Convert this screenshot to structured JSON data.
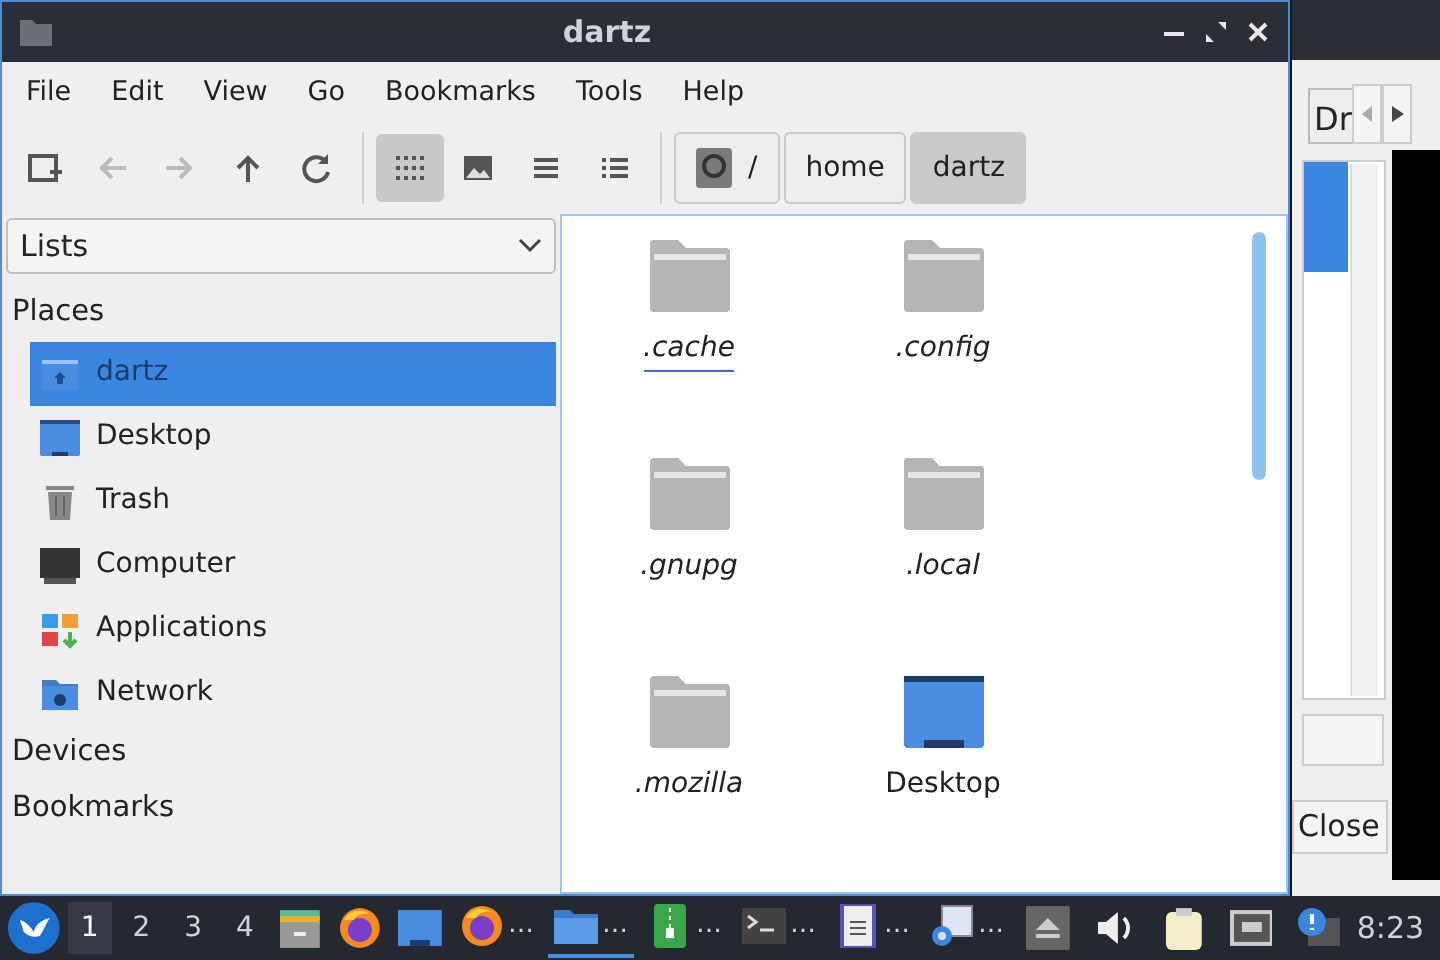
{
  "window": {
    "title": "dartz"
  },
  "menu": [
    "File",
    "Edit",
    "View",
    "Go",
    "Bookmarks",
    "Tools",
    "Help"
  ],
  "toolbar": {
    "nav": [
      {
        "kind": "newtab",
        "disabled": false
      },
      {
        "kind": "back",
        "disabled": true
      },
      {
        "kind": "forward",
        "disabled": true
      },
      {
        "kind": "up",
        "disabled": false
      },
      {
        "kind": "reload",
        "disabled": false
      }
    ],
    "views": [
      {
        "kind": "icons",
        "selected": true
      },
      {
        "kind": "thumbs",
        "selected": false
      },
      {
        "kind": "compact",
        "selected": false
      },
      {
        "kind": "detail",
        "selected": false
      }
    ],
    "path": [
      {
        "kind": "root",
        "label": "/",
        "selected": false
      },
      {
        "kind": "dir",
        "label": "home",
        "selected": false
      },
      {
        "kind": "dir",
        "label": "dartz",
        "selected": true
      }
    ]
  },
  "sidebar": {
    "dropdown": "Lists",
    "sections": [
      {
        "title": "Places",
        "items": [
          {
            "kind": "home",
            "label": "dartz",
            "selected": true
          },
          {
            "kind": "desktop",
            "label": "Desktop",
            "selected": false
          },
          {
            "kind": "trash",
            "label": "Trash",
            "selected": false
          },
          {
            "kind": "computer",
            "label": "Computer",
            "selected": false
          },
          {
            "kind": "apps",
            "label": "Applications",
            "selected": false
          },
          {
            "kind": "network",
            "label": "Network",
            "selected": false
          }
        ]
      },
      {
        "title": "Devices"
      },
      {
        "title": "Bookmarks"
      }
    ]
  },
  "files": [
    {
      "kind": "folder",
      "name": ".cache",
      "hidden": true,
      "focused": true
    },
    {
      "kind": "folder",
      "name": ".config",
      "hidden": true,
      "focused": false
    },
    {
      "kind": "folder",
      "name": ".gnupg",
      "hidden": true,
      "focused": false
    },
    {
      "kind": "folder",
      "name": ".local",
      "hidden": true,
      "focused": false
    },
    {
      "kind": "folder",
      "name": ".mozilla",
      "hidden": true,
      "focused": false
    },
    {
      "kind": "desktop",
      "name": "Desktop",
      "hidden": false,
      "focused": false
    }
  ],
  "back_window": {
    "tab": "Dr",
    "close_button": "Close"
  },
  "taskbar": {
    "workspaces": [
      {
        "label": "1",
        "selected": true
      },
      {
        "label": "2",
        "selected": false
      },
      {
        "label": "3",
        "selected": false
      },
      {
        "label": "4",
        "selected": false
      }
    ],
    "launchers": [
      {
        "kind": "cabinet"
      },
      {
        "kind": "firefox"
      },
      {
        "kind": "showdesktop"
      }
    ],
    "tasks": [
      {
        "kind": "firefox",
        "label": "…",
        "active": false
      },
      {
        "kind": "files",
        "label": "…",
        "active": true
      },
      {
        "kind": "archive",
        "label": "…",
        "active": false
      },
      {
        "kind": "terminal",
        "label": "…",
        "active": false
      },
      {
        "kind": "document",
        "label": "…",
        "active": false
      },
      {
        "kind": "settings",
        "label": "…",
        "active": false
      }
    ],
    "tray": [
      {
        "kind": "eject"
      },
      {
        "kind": "volume"
      },
      {
        "kind": "clipboard"
      },
      {
        "kind": "network"
      },
      {
        "kind": "notification"
      }
    ],
    "clock": "8:23"
  }
}
